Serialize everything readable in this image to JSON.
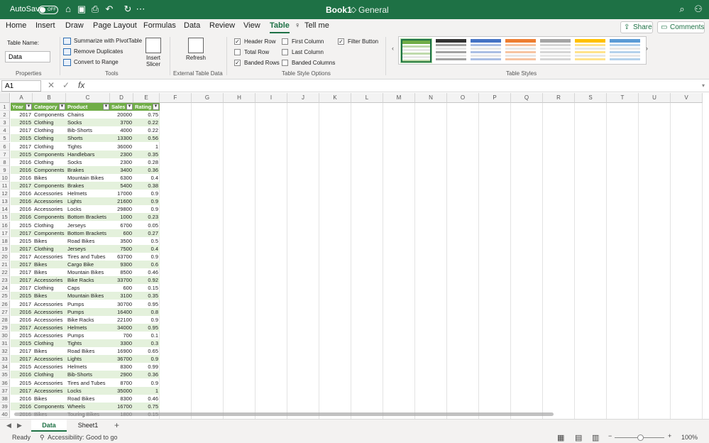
{
  "titlebar": {
    "autosave_label": "AutoSave",
    "autosave_state": "OFF",
    "workbook_name": "Book1",
    "sensitivity_label": "General"
  },
  "menu_tabs": [
    "Home",
    "Insert",
    "Draw",
    "Page Layout",
    "Formulas",
    "Data",
    "Review",
    "View",
    "Table",
    "Tell me"
  ],
  "active_tab": "Table",
  "share_label": "Share",
  "comments_label": "Comments",
  "ribbon": {
    "table_name_label": "Table Name:",
    "table_name_value": "Data",
    "properties_label": "Properties",
    "tools": [
      "Summarize with PivotTable",
      "Remove Duplicates",
      "Convert to Range"
    ],
    "insert_slicer": "Insert Slicer",
    "tools_label": "Tools",
    "refresh": "Refresh",
    "external_label": "External Table Data",
    "options": [
      {
        "label": "Header Row",
        "checked": true
      },
      {
        "label": "Total Row",
        "checked": false
      },
      {
        "label": "Banded Rows",
        "checked": true
      },
      {
        "label": "First Column",
        "checked": false
      },
      {
        "label": "Last Column",
        "checked": false
      },
      {
        "label": "Banded Columns",
        "checked": false
      },
      {
        "label": "Filter Button",
        "checked": true
      }
    ],
    "options_label": "Table Style Options",
    "styles_label": "Table Styles",
    "style_colors": [
      "#70ad47",
      "#333333",
      "#4472c4",
      "#ed7d31",
      "#a5a5a5",
      "#ffc000",
      "#5b9bd5"
    ]
  },
  "formula_bar": {
    "name_box": "A1",
    "fx": "fx",
    "formula": ""
  },
  "columns": [
    "A",
    "B",
    "C",
    "D",
    "E",
    "F",
    "G",
    "H",
    "I",
    "J",
    "K",
    "L",
    "M",
    "N",
    "O",
    "P",
    "Q",
    "R",
    "S",
    "T",
    "U",
    "V"
  ],
  "table": {
    "headers": [
      "Year",
      "Category",
      "Product",
      "Sales",
      "Rating"
    ],
    "rows": [
      [
        "2017",
        "Components",
        "Chains",
        "20000",
        "0.75"
      ],
      [
        "2015",
        "Clothing",
        "Socks",
        "3700",
        "0.22"
      ],
      [
        "2017",
        "Clothing",
        "Bib-Shorts",
        "4000",
        "0.22"
      ],
      [
        "2015",
        "Clothing",
        "Shorts",
        "13300",
        "0.56"
      ],
      [
        "2017",
        "Clothing",
        "Tights",
        "36000",
        "1"
      ],
      [
        "2015",
        "Components",
        "Handlebars",
        "2300",
        "0.35"
      ],
      [
        "2016",
        "Clothing",
        "Socks",
        "2300",
        "0.28"
      ],
      [
        "2016",
        "Components",
        "Brakes",
        "3400",
        "0.36"
      ],
      [
        "2016",
        "Bikes",
        "Mountain Bikes",
        "6300",
        "0.4"
      ],
      [
        "2017",
        "Components",
        "Brakes",
        "5400",
        "0.38"
      ],
      [
        "2016",
        "Accessories",
        "Helmets",
        "17000",
        "0.9"
      ],
      [
        "2016",
        "Accessories",
        "Lights",
        "21600",
        "0.9"
      ],
      [
        "2016",
        "Accessories",
        "Locks",
        "29800",
        "0.9"
      ],
      [
        "2016",
        "Components",
        "Bottom Brackets",
        "1000",
        "0.23"
      ],
      [
        "2015",
        "Clothing",
        "Jerseys",
        "6700",
        "0.05"
      ],
      [
        "2017",
        "Components",
        "Bottom Brackets",
        "600",
        "0.27"
      ],
      [
        "2015",
        "Bikes",
        "Road Bikes",
        "3500",
        "0.5"
      ],
      [
        "2017",
        "Clothing",
        "Jerseys",
        "7500",
        "0.4"
      ],
      [
        "2017",
        "Accessories",
        "Tires and Tubes",
        "63700",
        "0.9"
      ],
      [
        "2017",
        "Bikes",
        "Cargo Bike",
        "9300",
        "0.6"
      ],
      [
        "2017",
        "Bikes",
        "Mountain Bikes",
        "8500",
        "0.46"
      ],
      [
        "2017",
        "Accessories",
        "Bike Racks",
        "33700",
        "0.92"
      ],
      [
        "2017",
        "Clothing",
        "Caps",
        "600",
        "0.15"
      ],
      [
        "2015",
        "Bikes",
        "Mountain Bikes",
        "3100",
        "0.35"
      ],
      [
        "2017",
        "Accessories",
        "Pumps",
        "30700",
        "0.95"
      ],
      [
        "2016",
        "Accessories",
        "Pumps",
        "16400",
        "0.8"
      ],
      [
        "2016",
        "Accessories",
        "Bike Racks",
        "22100",
        "0.9"
      ],
      [
        "2017",
        "Accessories",
        "Helmets",
        "34000",
        "0.95"
      ],
      [
        "2015",
        "Accessories",
        "Pumps",
        "700",
        "0.1"
      ],
      [
        "2015",
        "Clothing",
        "Tights",
        "3300",
        "0.3"
      ],
      [
        "2017",
        "Bikes",
        "Road Bikes",
        "16900",
        "0.65"
      ],
      [
        "2017",
        "Accessories",
        "Lights",
        "36700",
        "0.9"
      ],
      [
        "2015",
        "Accessories",
        "Helmets",
        "8300",
        "0.99"
      ],
      [
        "2016",
        "Clothing",
        "Bib-Shorts",
        "2900",
        "0.36"
      ],
      [
        "2015",
        "Accessories",
        "Tires and Tubes",
        "8700",
        "0.9"
      ],
      [
        "2017",
        "Accessories",
        "Locks",
        "35000",
        "1"
      ],
      [
        "2016",
        "Bikes",
        "Road Bikes",
        "8300",
        "0.46"
      ],
      [
        "2016",
        "Components",
        "Wheels",
        "16700",
        "0.75"
      ],
      [
        "2016",
        "Bikes",
        "Touring Bikes",
        "1800",
        "0.15"
      ]
    ]
  },
  "sheets": [
    "Data",
    "Sheet1"
  ],
  "active_sheet": "Data",
  "status": {
    "ready": "Ready",
    "accessibility": "Accessibility: Good to go",
    "zoom": "100%"
  }
}
